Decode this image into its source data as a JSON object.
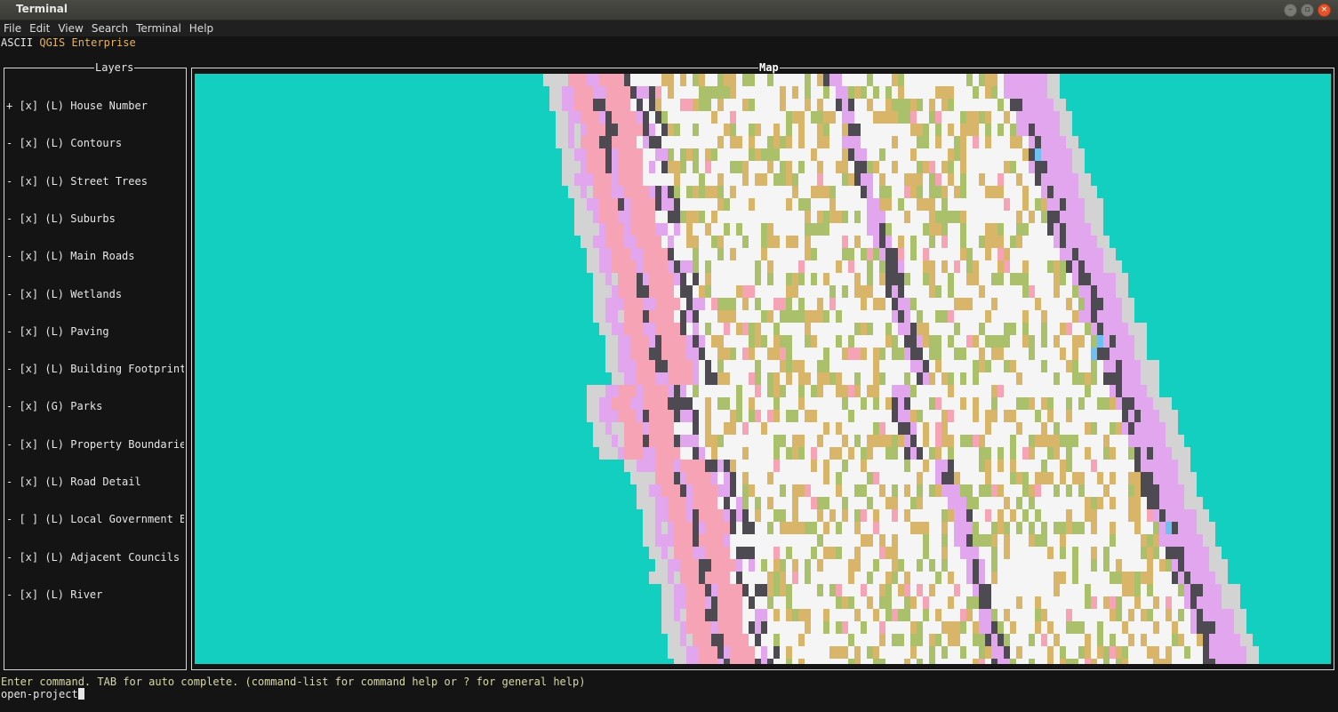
{
  "window": {
    "title": "Terminal"
  },
  "menu": [
    "File",
    "Edit",
    "View",
    "Search",
    "Terminal",
    "Help"
  ],
  "app": {
    "name_part1": "ASCII",
    "name_part2": "QGIS Enterprise"
  },
  "layers_panel": {
    "title": "Layers",
    "items": [
      {
        "text": "+ [x] (L) House Number"
      },
      {
        "text": "- [x] (L) Contours"
      },
      {
        "text": "- [x] (L) Street Trees"
      },
      {
        "text": "- [x] (L) Suburbs"
      },
      {
        "text": "- [x] (L) Main Roads"
      },
      {
        "text": "- [x] (L) Wetlands"
      },
      {
        "text": "- [x] (L) Paving"
      },
      {
        "text": "- [x] (L) Building Footprint"
      },
      {
        "text": "- [x] (G) Parks"
      },
      {
        "text": "- [x] (L) Property Boundarie"
      },
      {
        "text": "- [x] (L) Road Detail"
      },
      {
        "text": "- [ ] (L) Local Government B"
      },
      {
        "text": "- [x] (L) Adjacent Councils"
      },
      {
        "text": "- [x] (L) River"
      }
    ]
  },
  "map_panel": {
    "title": "Map",
    "colors": {
      "water": "#12cfc0",
      "pink": "#f6a3b5",
      "lavender": "#e2a6ee",
      "gray": "#d3d3d3",
      "white": "#f5f5f5",
      "tan": "#d9b56a",
      "olive": "#aac06a",
      "dark": "#4d4a52",
      "blue": "#6ec0f2"
    }
  },
  "command": {
    "hint": "Enter command. TAB for auto complete. (command-list for command help or ? for general help)",
    "input": "open-project"
  }
}
